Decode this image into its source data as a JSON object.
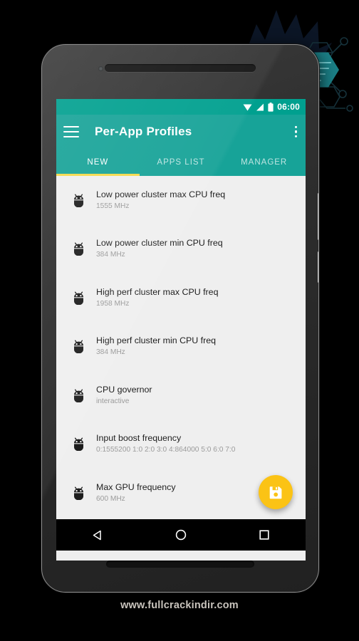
{
  "app": {
    "title": "Per-App Profiles",
    "menu_icon": "hamburger-menu-icon",
    "overflow_icon": "overflow-menu-icon"
  },
  "statusbar": {
    "time": "06:00",
    "icons": [
      "wifi-icon",
      "signal-icon",
      "battery-icon"
    ]
  },
  "tabs": [
    {
      "label": "NEW",
      "active": true
    },
    {
      "label": "APPS LIST",
      "active": false
    },
    {
      "label": "MANAGER",
      "active": false
    }
  ],
  "list": [
    {
      "icon": "android-robot-icon",
      "title": "Low power cluster max CPU freq",
      "value": "1555 MHz"
    },
    {
      "icon": "android-robot-icon",
      "title": "Low power cluster min CPU freq",
      "value": "384 MHz"
    },
    {
      "icon": "android-robot-icon",
      "title": "High perf cluster max CPU freq",
      "value": "1958 MHz"
    },
    {
      "icon": "android-robot-icon",
      "title": "High perf cluster min CPU freq",
      "value": "384 MHz"
    },
    {
      "icon": "android-robot-icon",
      "title": "CPU governor",
      "value": "interactive"
    },
    {
      "icon": "android-robot-icon",
      "title": "Input boost frequency",
      "value": "0:1555200 1:0 2:0 3:0 4:864000 5:0 6:0 7:0"
    },
    {
      "icon": "android-robot-icon",
      "title": "Max GPU frequency",
      "value": "600 MHz"
    }
  ],
  "fab": {
    "icon": "save-floppy-icon",
    "label": "Save"
  },
  "navbar": [
    {
      "icon": "back-triangle-icon"
    },
    {
      "icon": "home-circle-icon"
    },
    {
      "icon": "recents-square-icon"
    }
  ],
  "watermark": {
    "text": "www.fullcrackindir.com"
  },
  "colors": {
    "primary": "#17a398",
    "status_bar": "#00a08f",
    "accent": "#fbc315",
    "tab_indicator": "#f5d94a",
    "list_bg": "#efefef",
    "title_text": "#1e1e1e",
    "sub_text": "#9b9b9b",
    "hex_teal": "#1b7f86",
    "hex_orange": "#d68b1e"
  }
}
